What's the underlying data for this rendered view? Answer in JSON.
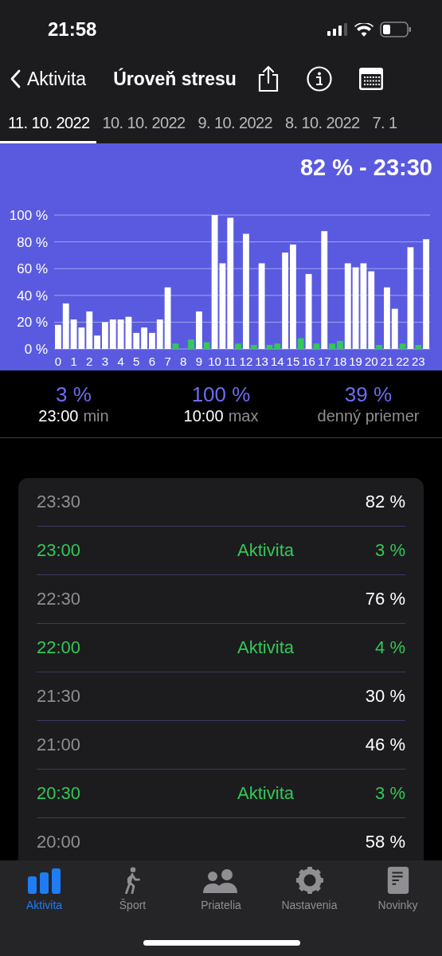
{
  "status_bar": {
    "time": "21:58"
  },
  "nav": {
    "back": "Aktivita",
    "title": "Úroveň stresu"
  },
  "date_tabs": [
    {
      "label": "11. 10. 2022",
      "selected": true
    },
    {
      "label": "10. 10. 2022",
      "selected": false
    },
    {
      "label": "9. 10. 2022",
      "selected": false
    },
    {
      "label": "8. 10. 2022",
      "selected": false
    },
    {
      "label": "7. 1",
      "selected": false
    }
  ],
  "chart": {
    "heading": "82 % - 23:30",
    "chart_data": {
      "type": "bar",
      "x": [
        0,
        0.5,
        1,
        1.5,
        2,
        2.5,
        3,
        3.5,
        4,
        4.5,
        5,
        5.5,
        6,
        6.5,
        7,
        7.5,
        8,
        8.5,
        9,
        9.5,
        10,
        10.5,
        11,
        11.5,
        12,
        12.5,
        13,
        13.5,
        14,
        14.5,
        15,
        15.5,
        16,
        16.5,
        17,
        17.5,
        18,
        18.5,
        19,
        19.5,
        20,
        20.5,
        21,
        21.5,
        22,
        22.5,
        23,
        23.5
      ],
      "series": [
        {
          "color": "#ffffff",
          "values": [
            18,
            34,
            22,
            16,
            28,
            10,
            20,
            22,
            22,
            24,
            12,
            16,
            12,
            22,
            46,
            null,
            null,
            null,
            28,
            null,
            100,
            64,
            98,
            null,
            86,
            null,
            64,
            null,
            null,
            72,
            78,
            null,
            56,
            null,
            88,
            null,
            null,
            64,
            61,
            64,
            58,
            null,
            46,
            30,
            null,
            76,
            null,
            82
          ]
        },
        {
          "color": "#34c759",
          "values": [
            null,
            null,
            null,
            null,
            null,
            null,
            null,
            null,
            null,
            null,
            null,
            null,
            null,
            null,
            null,
            4,
            null,
            7,
            null,
            5,
            null,
            null,
            null,
            4,
            null,
            3,
            null,
            3,
            4,
            null,
            null,
            8,
            null,
            4,
            null,
            4,
            6,
            null,
            null,
            null,
            null,
            3,
            null,
            null,
            4,
            null,
            3,
            null
          ]
        }
      ],
      "ylim": [
        0,
        100
      ],
      "xlim": [
        -0.25,
        23.75
      ],
      "grid": true,
      "yticks": [
        {
          "value": 0,
          "label": "0 %"
        },
        {
          "value": 20,
          "label": "20 %"
        },
        {
          "value": 40,
          "label": "40 %"
        },
        {
          "value": 60,
          "label": "60 %"
        },
        {
          "value": 80,
          "label": "80 %"
        },
        {
          "value": 100,
          "label": "100 %"
        }
      ],
      "xticks": [
        0,
        1,
        2,
        3,
        4,
        5,
        6,
        7,
        8,
        9,
        10,
        11,
        12,
        13,
        14,
        15,
        16,
        17,
        18,
        19,
        20,
        21,
        22,
        23
      ]
    }
  },
  "stats": [
    {
      "value": "3 %",
      "time": "23:00",
      "label": "min"
    },
    {
      "value": "100 %",
      "time": "10:00",
      "label": "max"
    },
    {
      "value": "39 %",
      "label": "denný priemer"
    }
  ],
  "rows": [
    {
      "kind": "stress",
      "time": "23:30",
      "value": "82 %"
    },
    {
      "kind": "activity",
      "time": "23:00",
      "label": "Aktivita",
      "value": "3 %"
    },
    {
      "kind": "stress",
      "time": "22:30",
      "value": "76 %"
    },
    {
      "kind": "activity",
      "time": "22:00",
      "label": "Aktivita",
      "value": "4 %"
    },
    {
      "kind": "stress",
      "time": "21:30",
      "value": "30 %"
    },
    {
      "kind": "stress",
      "time": "21:00",
      "value": "46 %"
    },
    {
      "kind": "activity",
      "time": "20:30",
      "label": "Aktivita",
      "value": "3 %"
    },
    {
      "kind": "stress",
      "time": "20:00",
      "value": "58 %"
    }
  ],
  "tab_bar": [
    {
      "kind": "activity",
      "label": "Aktivita",
      "selected": true
    },
    {
      "kind": "sport",
      "label": "Šport",
      "selected": false
    },
    {
      "kind": "friends",
      "label": "Priatelia",
      "selected": false
    },
    {
      "kind": "settings",
      "label": "Nastavenia",
      "selected": false
    },
    {
      "kind": "news",
      "label": "Novinky",
      "selected": false
    }
  ]
}
